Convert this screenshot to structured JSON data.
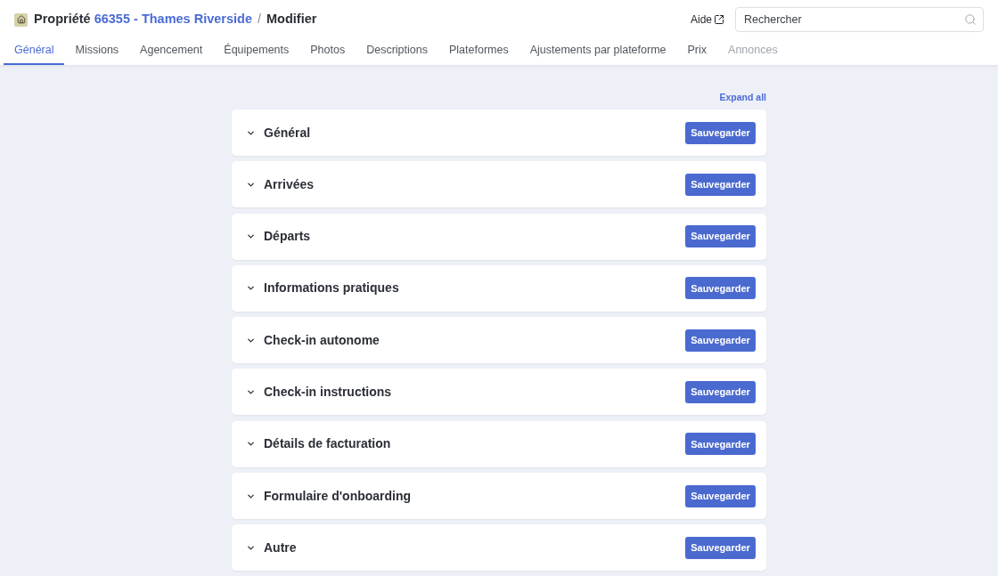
{
  "header": {
    "breadcrumb": {
      "label": "Propriété",
      "property_link": "66355 - Thames Riverside",
      "separator": "/",
      "current": "Modifier"
    },
    "help_link": "Aide",
    "search": {
      "placeholder": "Rechercher"
    }
  },
  "tabs": [
    {
      "label": "Général",
      "selected": true,
      "disabled": false
    },
    {
      "label": "Missions",
      "selected": false,
      "disabled": false
    },
    {
      "label": "Agencement",
      "selected": false,
      "disabled": false
    },
    {
      "label": "Équipements",
      "selected": false,
      "disabled": false
    },
    {
      "label": "Photos",
      "selected": false,
      "disabled": false
    },
    {
      "label": "Descriptions",
      "selected": false,
      "disabled": false
    },
    {
      "label": "Plateformes",
      "selected": false,
      "disabled": false
    },
    {
      "label": "Ajustements par plateforme",
      "selected": false,
      "disabled": false
    },
    {
      "label": "Prix",
      "selected": false,
      "disabled": false
    },
    {
      "label": "Annonces",
      "selected": false,
      "disabled": true
    }
  ],
  "expand_all": "Expand all",
  "sections": [
    {
      "title": "Général",
      "expanded": false,
      "button": "Sauvegarder"
    },
    {
      "title": "Arrivées",
      "expanded": false,
      "button": "Sauvegarder"
    },
    {
      "title": "Départs",
      "expanded": false,
      "button": "Sauvegarder"
    },
    {
      "title": "Informations pratiques",
      "expanded": false,
      "button": "Sauvegarder"
    },
    {
      "title": "Check-in autonome",
      "expanded": false,
      "button": "Sauvegarder"
    },
    {
      "title": "Check-in instructions",
      "expanded": false,
      "button": "Sauvegarder"
    },
    {
      "title": "Détails de facturation",
      "expanded": false,
      "button": "Sauvegarder"
    },
    {
      "title": "Formulaire d'onboarding",
      "expanded": false,
      "button": "Sauvegarder"
    },
    {
      "title": "Autre",
      "expanded": false,
      "button": "Sauvegarder"
    }
  ]
}
